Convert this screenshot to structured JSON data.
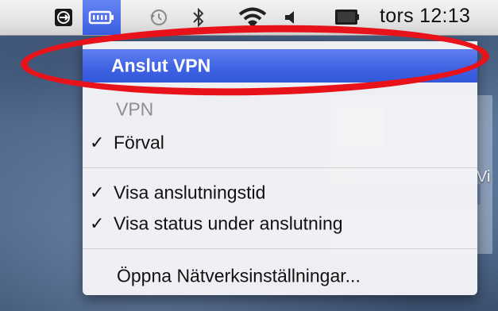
{
  "menubar": {
    "clock": "tors 12:13",
    "icons": [
      "scroll-lock-icon",
      "battery-icon",
      "time-machine-icon",
      "bluetooth-icon",
      "wifi-icon",
      "volume-icon",
      "display-mirror-icon"
    ]
  },
  "desktop": {
    "partial_text": "Vi"
  },
  "vpn_menu": {
    "connect": "Anslut VPN",
    "section_header": "VPN",
    "items": [
      {
        "label": "Förval",
        "checked": true
      },
      {
        "label": "Visa anslutningstid",
        "checked": true
      },
      {
        "label": "Visa status under anslutning",
        "checked": true
      },
      {
        "label": "Öppna Nätverksinställningar...",
        "checked": false
      }
    ],
    "check_glyph": "✓"
  },
  "colors": {
    "highlight": "#3e62e3",
    "annotation": "#e8121b",
    "disabled_text": "#8f8f8f"
  }
}
